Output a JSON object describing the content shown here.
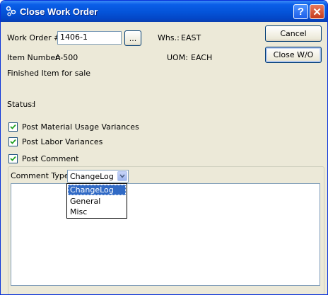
{
  "window": {
    "title": "Close Work Order",
    "help_label": "?",
    "close_label": "✕"
  },
  "form": {
    "work_order_label": "Work Order #:",
    "work_order_value": "1406-1",
    "lookup_label": "...",
    "whs_label": "Whs.:",
    "whs_value": "EAST",
    "item_number_label": "Item Number:",
    "item_number_value": "A-500",
    "uom_label": "UOM:",
    "uom_value": "EACH",
    "item_description": "Finished Item for sale",
    "status_label": "Status:",
    "status_value": "I"
  },
  "buttons": {
    "cancel": "Cancel",
    "close_wo": "Close W/O"
  },
  "options": [
    {
      "label": "Post Material Usage Variances",
      "checked": true
    },
    {
      "label": "Post Labor Variances",
      "checked": true
    },
    {
      "label": "Post Comment",
      "checked": true
    }
  ],
  "comment": {
    "type_label": "Comment Type:",
    "type_value": "ChangeLog",
    "dropdown_options": [
      "ChangeLog",
      "General",
      "Misc"
    ],
    "text": ""
  },
  "colors": {
    "titlebar": "#0453d8",
    "face": "#ece9d8",
    "selection": "#316ac5"
  }
}
